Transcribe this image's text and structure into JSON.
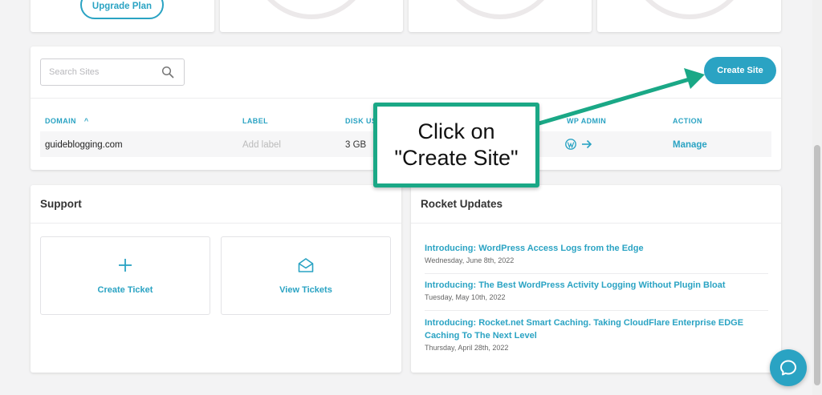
{
  "top_cards": {
    "upgrade_label": "Upgrade Plan"
  },
  "sites": {
    "search_placeholder": "Search Sites",
    "create_label": "Create Site",
    "columns": [
      "DOMAIN",
      "LABEL",
      "DISK US",
      "WP ADMIN",
      "ACTION"
    ],
    "sort_indicator": "^",
    "rows": [
      {
        "domain": "guideblogging.com",
        "label": "Add label",
        "disk": "3 GB",
        "action": "Manage"
      }
    ]
  },
  "support": {
    "title": "Support",
    "create_ticket": "Create Ticket",
    "view_tickets": "View Tickets"
  },
  "updates": {
    "title": "Rocket Updates",
    "items": [
      {
        "title": "Introducing: WordPress Access Logs from the Edge",
        "date": "Wednesday, June 8th, 2022"
      },
      {
        "title": "Introducing: The Best WordPress Activity Logging Without Plugin Bloat",
        "date": "Tuesday, May 10th, 2022"
      },
      {
        "title": "Introducing: Rocket.net Smart Caching. Taking CloudFlare Enterprise EDGE Caching To The Next Level",
        "date": "Thursday, April 28th, 2022"
      }
    ]
  },
  "callout": {
    "line1": "Click on",
    "line2": "\"Create Site\""
  },
  "colors": {
    "accent": "#2aa3c3",
    "callout_border": "#1aa886"
  },
  "icons": [
    "search-icon",
    "plus-icon",
    "envelope-open-icon",
    "wordpress-icon",
    "arrow-right-icon",
    "chat-icon"
  ]
}
